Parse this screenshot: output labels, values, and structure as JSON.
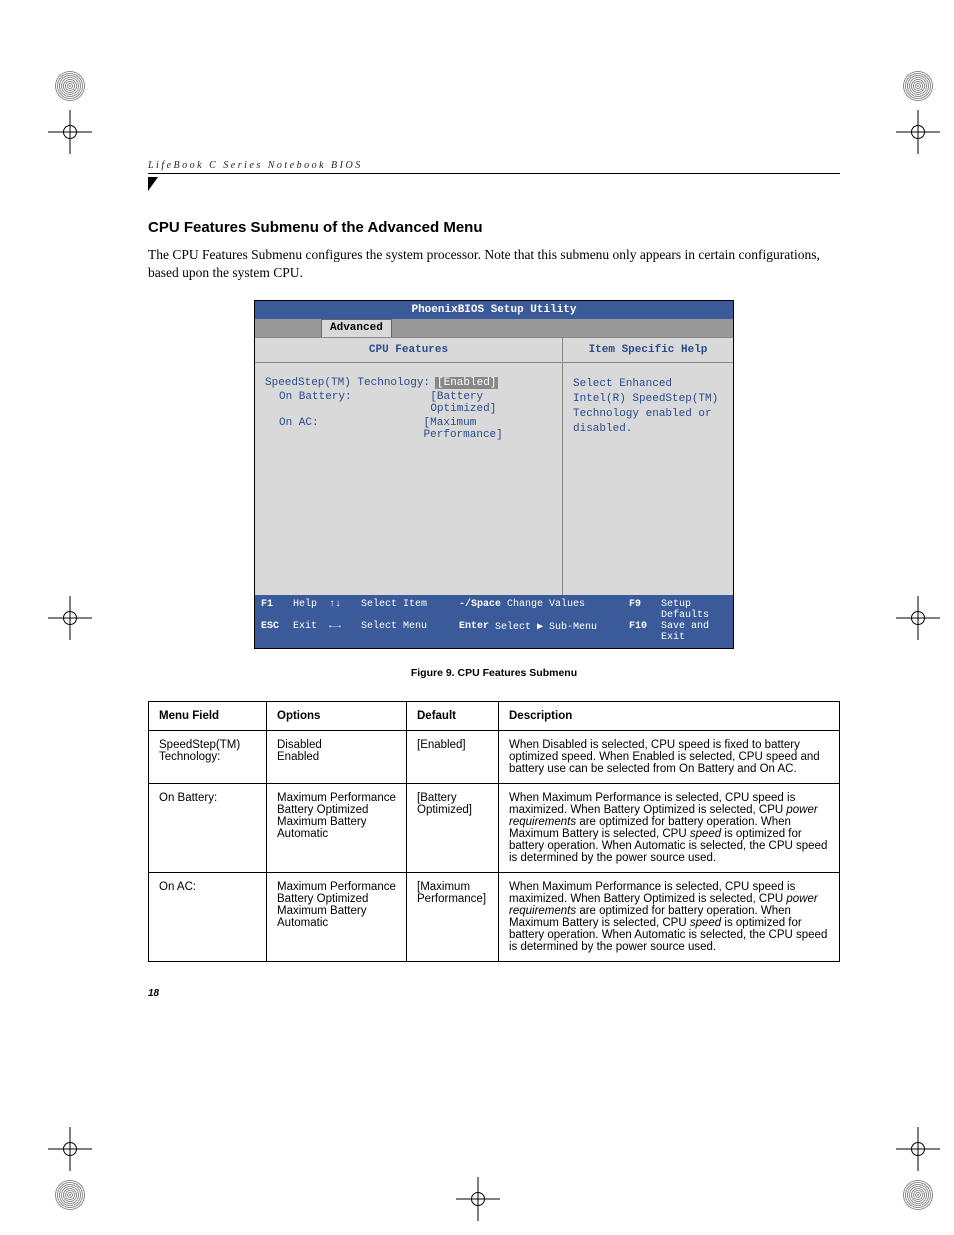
{
  "running_head": "LifeBook C Series Notebook BIOS",
  "heading": "CPU Features Submenu of the Advanced Menu",
  "intro": "The CPU Features Submenu configures the system processor. Note that this submenu only appears in certain configurations, based upon the system CPU.",
  "bios": {
    "title": "PhoenixBIOS Setup Utility",
    "active_tab": "Advanced",
    "left_title": "CPU Features",
    "right_title": "Item Specific Help",
    "rows": [
      {
        "label": "SpeedStep(TM) Technology:",
        "value": "[Enabled]",
        "selected": true,
        "indent": false
      },
      {
        "label": "On Battery:",
        "value": "[Battery Optimized]",
        "selected": false,
        "indent": true
      },
      {
        "label": "On AC:",
        "value": "[Maximum Performance]",
        "selected": false,
        "indent": true
      }
    ],
    "help_text": "Select Enhanced Intel(R) SpeedStep(TM) Technology enabled or disabled.",
    "footer": {
      "row1": [
        {
          "key": "F1",
          "label": "Help"
        },
        {
          "key": "↑↓",
          "label": "Select Item"
        },
        {
          "key": "-/Space",
          "label": "Change Values"
        },
        {
          "key": "F9",
          "label": "Setup Defaults"
        }
      ],
      "row2": [
        {
          "key": "ESC",
          "label": "Exit"
        },
        {
          "key": "←→",
          "label": "Select Menu"
        },
        {
          "key": "Enter",
          "label": "Select ▶ Sub-Menu"
        },
        {
          "key": "F10",
          "label": "Save and Exit"
        }
      ]
    }
  },
  "figure_caption": "Figure 9.  CPU Features Submenu",
  "table": {
    "headers": [
      "Menu Field",
      "Options",
      "Default",
      "Description"
    ],
    "rows": [
      {
        "field": "SpeedStep(TM) Technology:",
        "options": [
          "Disabled",
          "Enabled"
        ],
        "default": "[Enabled]",
        "description_html": "When Disabled is selected, CPU speed is fixed to battery optimized speed. When Enabled is selected, CPU speed and battery use can be selected from On Battery and On AC."
      },
      {
        "field": "On Battery:",
        "options": [
          "Maximum Performance",
          "Battery Optimized",
          "Maximum Battery",
          "Automatic"
        ],
        "default": "[Battery Optimized]",
        "description_html": "When Maximum Performance is selected, CPU speed is maximized. When Battery Optimized is selected, CPU <em class='i'>power requirements</em> are optimized for battery operation. When Maximum Battery is selected, CPU <em class='i'>speed</em> is optimized for battery operation. When Automatic is selected, the CPU speed is determined by the power source used."
      },
      {
        "field": "On AC:",
        "options": [
          "Maximum Performance",
          "Battery Optimized",
          "Maximum Battery",
          "Automatic"
        ],
        "default": "[Maximum Performance]",
        "description_html": "When Maximum Performance is selected, CPU speed is maximized. When Battery Optimized is selected, CPU <em class='i'>power requirements</em> are optimized for battery operation. When Maximum Battery is selected, CPU <em class='i'>speed</em> is optimized for battery operation. When Automatic is selected, the CPU speed is determined by the power source used."
      }
    ]
  },
  "page_number": "18"
}
